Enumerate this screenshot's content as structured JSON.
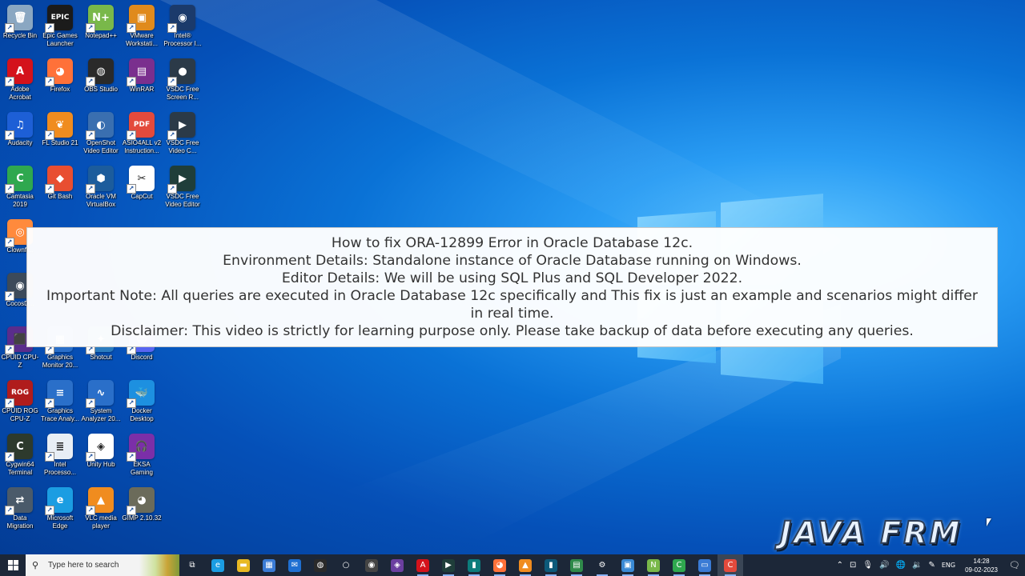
{
  "desktop": {
    "icons": [
      {
        "label": "Recycle Bin",
        "icon": "recycle-bin-icon",
        "color": "#8aa7c2",
        "glyph": "🗑"
      },
      {
        "label": "Epic Games Launcher",
        "icon": "epic-games-icon",
        "color": "#1b1b1b",
        "glyph": "EPIC"
      },
      {
        "label": "Notepad++",
        "icon": "notepad-plus-plus-icon",
        "color": "#79b84a",
        "glyph": "N+"
      },
      {
        "label": "VMware Workstati...",
        "icon": "vmware-icon",
        "color": "#e08a1c",
        "glyph": "▣"
      },
      {
        "label": "Intel® Processor I...",
        "icon": "intel-processor-icon",
        "color": "#1b3a6b",
        "glyph": "◉"
      },
      {
        "label": "Adobe Acrobat",
        "icon": "adobe-acrobat-icon",
        "color": "#d4121b",
        "glyph": "A"
      },
      {
        "label": "Firefox",
        "icon": "firefox-icon",
        "color": "#ff7139",
        "glyph": "◕"
      },
      {
        "label": "OBS Studio",
        "icon": "obs-studio-icon",
        "color": "#2a2a2a",
        "glyph": "◍"
      },
      {
        "label": "WinRAR",
        "icon": "winrar-icon",
        "color": "#7a2f8e",
        "glyph": "▤"
      },
      {
        "label": "VSDC Free Screen R...",
        "icon": "vsdc-screen-recorder-icon",
        "color": "#2b3a48",
        "glyph": "●"
      },
      {
        "label": "Audacity",
        "icon": "audacity-icon",
        "color": "#1d5fd6",
        "glyph": "♫"
      },
      {
        "label": "FL Studio 21",
        "icon": "fl-studio-icon",
        "color": "#f08c1f",
        "glyph": "❦"
      },
      {
        "label": "OpenShot Video Editor",
        "icon": "openshot-icon",
        "color": "#3a6fb0",
        "glyph": "◐"
      },
      {
        "label": "ASIO4ALL v2 Instruction...",
        "icon": "pdf-document-icon",
        "color": "#e34a3c",
        "glyph": "PDF"
      },
      {
        "label": "VSDC Free Video C...",
        "icon": "vsdc-video-converter-icon",
        "color": "#2b3a48",
        "glyph": "▶"
      },
      {
        "label": "Camtasia 2019",
        "icon": "camtasia-icon",
        "color": "#2fa84f",
        "glyph": "C"
      },
      {
        "label": "Git Bash",
        "icon": "git-bash-icon",
        "color": "#e84e31",
        "glyph": "◆"
      },
      {
        "label": "Oracle VM VirtualBox",
        "icon": "virtualbox-icon",
        "color": "#1c5c9c",
        "glyph": "⬢"
      },
      {
        "label": "CapCut",
        "icon": "capcut-icon",
        "color": "#ffffff",
        "glyph": "✂"
      },
      {
        "label": "VSDC Free Video Editor",
        "icon": "vsdc-video-editor-icon",
        "color": "#1f3e3a",
        "glyph": "▶"
      },
      {
        "label": "Clownfi...",
        "icon": "clownfish-icon",
        "color": "#ff8a3c",
        "glyph": "◎"
      },
      {
        "label": "CocosD...",
        "icon": "cocos-icon",
        "color": "#3c4a5a",
        "glyph": "◉"
      },
      {
        "label": "CPUID CPU-Z",
        "icon": "cpu-z-icon",
        "color": "#5a2d8c",
        "glyph": "⬛"
      },
      {
        "label": "Graphics Monitor 20...",
        "icon": "graphics-monitor-icon",
        "color": "#2a6fc9",
        "glyph": "▦"
      },
      {
        "label": "Shotcut",
        "icon": "shotcut-icon",
        "color": "#2b7cbf",
        "glyph": "✦"
      },
      {
        "label": "Discord",
        "icon": "discord-icon",
        "color": "#5865f2",
        "glyph": "☺"
      },
      {
        "label": "CPUID ROG CPU-Z",
        "icon": "rog-cpu-z-icon",
        "color": "#b01c1c",
        "glyph": "ROG"
      },
      {
        "label": "Graphics Trace Analy...",
        "icon": "graphics-trace-icon",
        "color": "#2a6fc9",
        "glyph": "≡"
      },
      {
        "label": "System Analyzer 20...",
        "icon": "system-analyzer-icon",
        "color": "#2a6fc9",
        "glyph": "∿"
      },
      {
        "label": "Docker Desktop",
        "icon": "docker-icon",
        "color": "#1d90e0",
        "glyph": "🐳"
      },
      {
        "label": "Cygwin64 Terminal",
        "icon": "cygwin-terminal-icon",
        "color": "#2d3a2d",
        "glyph": "C"
      },
      {
        "label": "Intel Processo...",
        "icon": "intel-document-icon",
        "color": "#e8eef5",
        "glyph": "≣"
      },
      {
        "label": "Unity Hub",
        "icon": "unity-hub-icon",
        "color": "#ffffff",
        "glyph": "◈"
      },
      {
        "label": "EKSA Gaming Headset",
        "icon": "headset-icon",
        "color": "#7b2fa8",
        "glyph": "🎧"
      },
      {
        "label": "Data Migration",
        "icon": "data-migration-icon",
        "color": "#4a5a6a",
        "glyph": "⇄"
      },
      {
        "label": "Microsoft Edge",
        "icon": "edge-icon",
        "color": "#1b9de2",
        "glyph": "e"
      },
      {
        "label": "VLC media player",
        "icon": "vlc-icon",
        "color": "#f08c1f",
        "glyph": "▲"
      },
      {
        "label": "GIMP 2.10.32",
        "icon": "gimp-icon",
        "color": "#6b6b5a",
        "glyph": "◕"
      }
    ]
  },
  "overlay": {
    "lines": [
      "How to fix ORA-12899 Error in Oracle Database 12c.",
      "Environment Details: Standalone instance of Oracle Database running on Windows.",
      "Editor Details: We will be using SQL Plus and SQL Developer 2022.",
      "Important Note: All queries are executed in Oracle Database 12c specifically and This fix is just an example and scenarios might differ",
      "in real time.",
      "Disclaimer: This video is strictly for learning purpose only. Please take backup of data before executing any queries."
    ]
  },
  "watermark": {
    "text": "JAVA FRM"
  },
  "taskbar": {
    "search_placeholder": "Type here to search",
    "buttons": [
      {
        "icon": "task-view-icon",
        "glyph": "⧉",
        "color": "transparent"
      },
      {
        "icon": "edge-icon",
        "glyph": "e",
        "color": "#1b9de2"
      },
      {
        "icon": "file-explorer-icon",
        "glyph": "▬",
        "color": "#e8b923"
      },
      {
        "icon": "microsoft-store-icon",
        "glyph": "▦",
        "color": "#3a7bd5"
      },
      {
        "icon": "mail-icon",
        "glyph": "✉",
        "color": "#1f6fd1"
      },
      {
        "icon": "obs-studio-icon",
        "glyph": "◍",
        "color": "#2a2a2a"
      },
      {
        "icon": "cortana-icon",
        "glyph": "○",
        "color": "transparent"
      },
      {
        "icon": "chrome-icon",
        "glyph": "◉",
        "color": "#444"
      },
      {
        "icon": "app-icon",
        "glyph": "◈",
        "color": "#6b3fa0"
      },
      {
        "icon": "adobe-acrobat-icon",
        "glyph": "A",
        "color": "#d4121b"
      },
      {
        "icon": "vsdc-icon",
        "glyph": "▶",
        "color": "#1f3e3a"
      },
      {
        "icon": "teal-app-icon",
        "glyph": "▮",
        "color": "#0c7c7c"
      },
      {
        "icon": "firefox-icon",
        "glyph": "◕",
        "color": "#ff7139"
      },
      {
        "icon": "vlc-icon",
        "glyph": "▲",
        "color": "#f08c1f"
      },
      {
        "icon": "sql-developer-icon",
        "glyph": "▮",
        "color": "#0d5a7a"
      },
      {
        "icon": "sheet-app-icon",
        "glyph": "▤",
        "color": "#2f8a4a"
      },
      {
        "icon": "settings-icon",
        "glyph": "⚙",
        "color": "transparent"
      },
      {
        "icon": "remote-desktop-icon",
        "glyph": "▣",
        "color": "#3a8ad5"
      },
      {
        "icon": "notepad-plus-plus-icon",
        "glyph": "N",
        "color": "#79b84a"
      },
      {
        "icon": "camtasia-icon",
        "glyph": "C",
        "color": "#2fa84f"
      },
      {
        "icon": "window-app-icon",
        "glyph": "▭",
        "color": "#3a7bd5"
      },
      {
        "icon": "camtasia-recorder-icon",
        "glyph": "C",
        "color": "#e34a3c"
      }
    ],
    "tray": {
      "icons": [
        {
          "icon": "chevron-up-icon",
          "glyph": "⌃"
        },
        {
          "icon": "network-device-icon",
          "glyph": "⊡"
        },
        {
          "icon": "microphone-icon",
          "glyph": "🎙"
        },
        {
          "icon": "volume-icon",
          "glyph": "🔊"
        },
        {
          "icon": "globe-network-icon",
          "glyph": "🌐"
        },
        {
          "icon": "speaker-icon",
          "glyph": "🔉"
        },
        {
          "icon": "pen-icon",
          "glyph": "✎"
        }
      ],
      "language": "ENG",
      "time": "14:28",
      "date": "09-02-2023"
    }
  }
}
